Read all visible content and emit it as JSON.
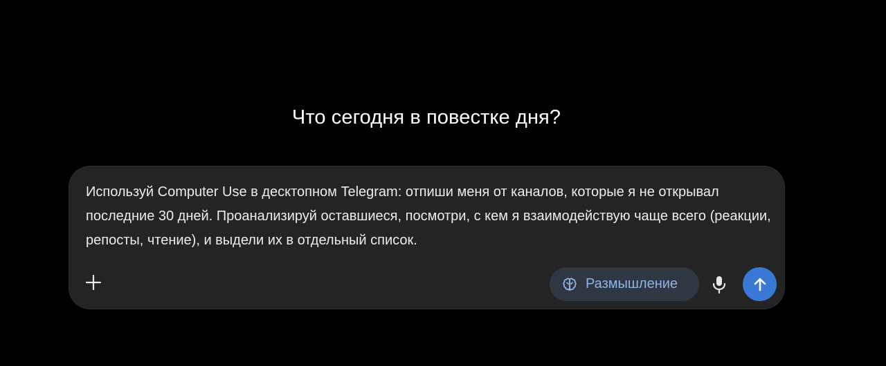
{
  "heading": "Что сегодня в повестке дня?",
  "composer": {
    "prompt_value": "Используй Computer Use в десктопном Telegram: отпиши меня от каналов, которые я не открывал последние 30 дней. Проанализируй оставшиеся, посмотри, с кем я взаимодействую чаще всего (реакции, репосты, чтение), и выдели их в отдельный список.",
    "add_icon": "plus-icon",
    "thinking_chip": {
      "label": "Размышление",
      "icon": "brain-icon",
      "color": "#8fb3e6"
    },
    "mic_icon": "microphone-icon",
    "send_icon": "arrow-up-icon",
    "send_color": "#3a78d6"
  }
}
